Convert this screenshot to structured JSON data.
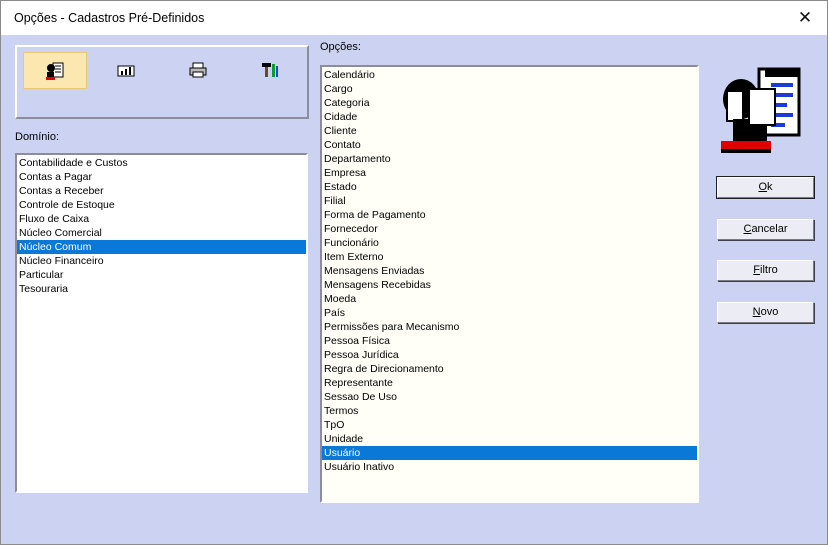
{
  "window": {
    "title": "Opções - Cadastros Pré-Definidos"
  },
  "toolbar": {
    "tools": [
      {
        "icon": "user-document-icon",
        "active": true
      },
      {
        "icon": "chart-icon",
        "active": false
      },
      {
        "icon": "printer-icon",
        "active": false
      },
      {
        "icon": "tools-icon",
        "active": false
      }
    ]
  },
  "dominio": {
    "label": "Domínio:",
    "items": [
      "Contabilidade e Custos",
      "Contas a Pagar",
      "Contas a Receber",
      "Controle de Estoque",
      "Fluxo de Caixa",
      "Núcleo Comercial",
      "Núcleo Comum",
      "Núcleo Financeiro",
      "Particular",
      "Tesouraria"
    ],
    "selected": "Núcleo Comum"
  },
  "opcoes": {
    "label": "Opções:",
    "items": [
      "Calendário",
      "Cargo",
      "Categoria",
      "Cidade",
      "Cliente",
      "Contato",
      "Departamento",
      "Empresa",
      "Estado",
      "Filial",
      "Forma de Pagamento",
      "Fornecedor",
      "Funcionário",
      "Item Externo",
      "Mensagens Enviadas",
      "Mensagens Recebidas",
      "Moeda",
      "País",
      "Permissões para Mecanismo",
      "Pessoa Física",
      "Pessoa Jurídica",
      "Regra de Direcionamento",
      "Representante",
      "Sessao De Uso",
      "Termos",
      "TpO",
      "Unidade",
      "Usuário",
      "Usuário Inativo"
    ],
    "selected": "Usuário"
  },
  "buttons": {
    "ok": {
      "first": "O",
      "rest": "k"
    },
    "cancelar": {
      "first": "C",
      "rest": "ancelar"
    },
    "filtro": {
      "first": "F",
      "rest": "iltro"
    },
    "novo": {
      "first": "N",
      "rest": "ovo"
    }
  },
  "colors": {
    "dialog_bg": "#ccd3f2",
    "selection": "#0a78d7",
    "active_tool": "#fde7b0"
  }
}
